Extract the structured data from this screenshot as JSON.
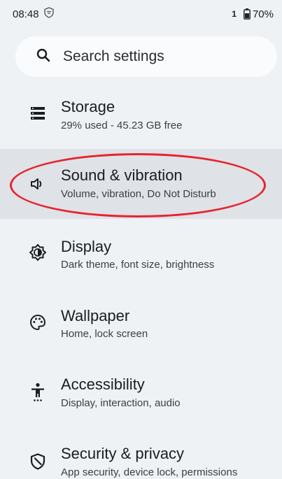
{
  "status_bar": {
    "time": "08:48",
    "notification_badge": "1",
    "battery": "70%"
  },
  "search": {
    "placeholder": "Search settings",
    "icon": "search-icon"
  },
  "settings": [
    {
      "title": "Storage",
      "subtitle": "29% used - 45.23 GB free",
      "icon": "storage-icon"
    },
    {
      "title": "Sound & vibration",
      "subtitle": "Volume, vibration, Do Not Disturb",
      "icon": "speaker-icon"
    },
    {
      "title": "Display",
      "subtitle": "Dark theme, font size, brightness",
      "icon": "brightness-icon"
    },
    {
      "title": "Wallpaper",
      "subtitle": "Home, lock screen",
      "icon": "palette-icon"
    },
    {
      "title": "Accessibility",
      "subtitle": "Display, interaction, audio",
      "icon": "accessibility-icon"
    },
    {
      "title": "Security & privacy",
      "subtitle": "App security, device lock, permissions",
      "icon": "shield-icon"
    }
  ],
  "annotation": {
    "color": "#e8232f",
    "target": "Sound & vibration"
  }
}
